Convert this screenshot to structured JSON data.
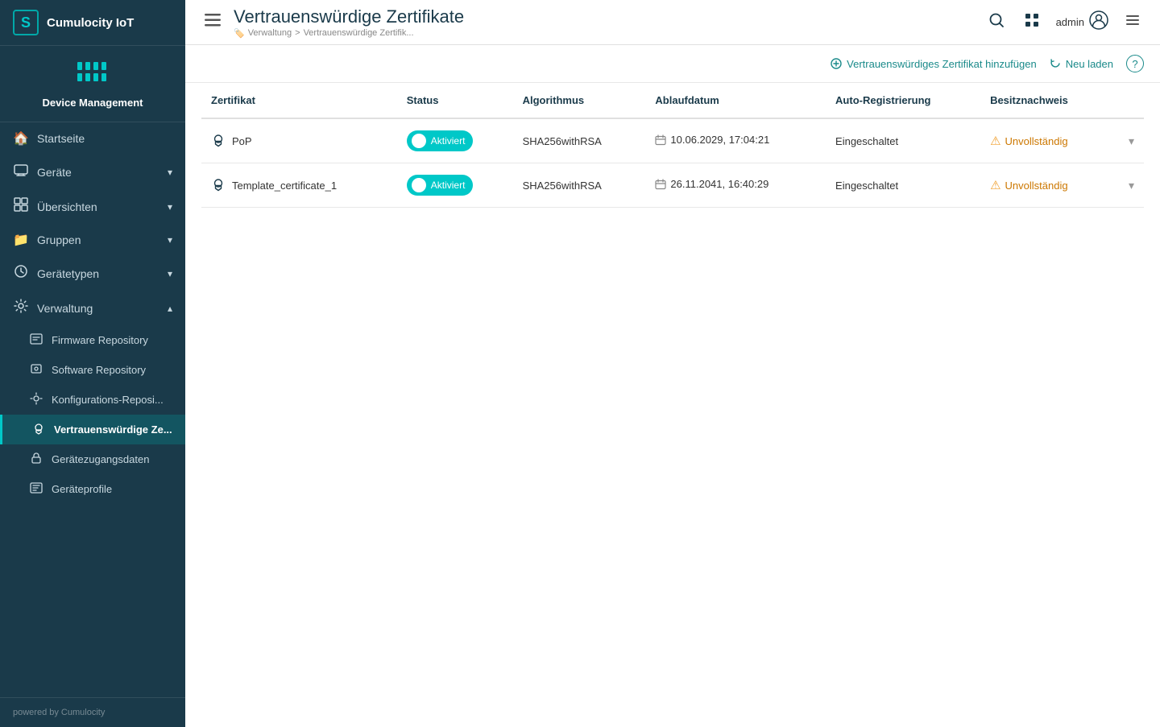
{
  "brand": {
    "logo_letter": "S",
    "name": "Cumulocity IoT"
  },
  "device_management": {
    "label": "Device Management"
  },
  "sidebar": {
    "nav_items": [
      {
        "id": "startseite",
        "label": "Startseite",
        "icon": "🏠",
        "has_children": false
      },
      {
        "id": "geraete",
        "label": "Geräte",
        "icon": "📱",
        "has_children": true
      },
      {
        "id": "uebersichten",
        "label": "Übersichten",
        "icon": "📊",
        "has_children": true
      },
      {
        "id": "gruppen",
        "label": "Gruppen",
        "icon": "📁",
        "has_children": true
      },
      {
        "id": "geraetetypen",
        "label": "Gerätetypen",
        "icon": "🔧",
        "has_children": true
      },
      {
        "id": "verwaltung",
        "label": "Verwaltung",
        "icon": "⚙️",
        "has_children": true,
        "expanded": true
      }
    ],
    "sub_items": [
      {
        "id": "firmware-repository",
        "label": "Firmware Repository",
        "icon": "💾",
        "active": false
      },
      {
        "id": "software-repository",
        "label": "Software Repository",
        "icon": "📦",
        "active": false
      },
      {
        "id": "konfigurations-reposi",
        "label": "Konfigurations-Reposi...",
        "icon": "⚙️",
        "active": false
      },
      {
        "id": "vertrauenswuerdige-ze",
        "label": "Vertrauenswürdige Ze...",
        "icon": "🔒",
        "active": true
      },
      {
        "id": "geraetezugangsdaten",
        "label": "Gerätezugangsdaten",
        "icon": "🔑",
        "active": false
      },
      {
        "id": "geraeteprofile",
        "label": "Geräteprofile",
        "icon": "📋",
        "active": false
      }
    ],
    "footer": "powered by Cumulocity"
  },
  "topbar": {
    "title": "Vertrauenswürdige Zertifikate",
    "breadcrumb_icon": "🏷️",
    "breadcrumb_parent": "Verwaltung",
    "breadcrumb_separator": ">",
    "breadcrumb_current": "Vertrauenswürdige Zertifik...",
    "user": "admin"
  },
  "action_bar": {
    "add_label": "Vertrauenswürdiges Zertifikat hinzufügen",
    "reload_label": "Neu laden",
    "help_label": "?"
  },
  "table": {
    "columns": [
      "Zertifikat",
      "Status",
      "Algorithmus",
      "Ablaufdatum",
      "Auto-Registrierung",
      "Besitznachweis"
    ],
    "rows": [
      {
        "zertifikat": "PoP",
        "status": "Aktiviert",
        "algorithmus": "SHA256withRSA",
        "ablaufdatum": "10.06.2029, 17:04:21",
        "auto_registrierung": "Eingeschaltet",
        "besitznachweis": "Unvollständig"
      },
      {
        "zertifikat": "Template_certificate_1",
        "status": "Aktiviert",
        "algorithmus": "SHA256withRSA",
        "ablaufdatum": "26.11.2041, 16:40:29",
        "auto_registrierung": "Eingeschaltet",
        "besitznachweis": "Unvollständig"
      }
    ]
  }
}
